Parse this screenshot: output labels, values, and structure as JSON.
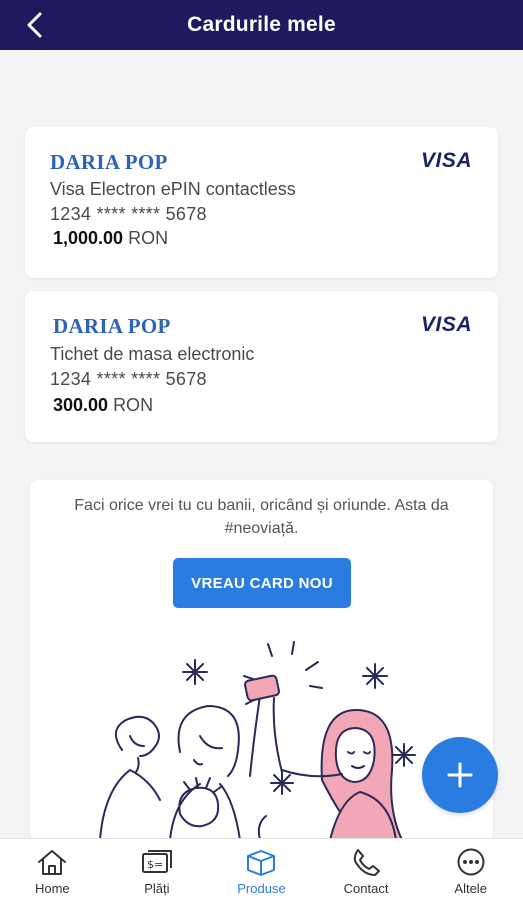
{
  "header": {
    "title": "Cardurile mele"
  },
  "cards": [
    {
      "owner": "DARIA POP",
      "brand": "VISA",
      "type": "Visa Electron ePIN contactless",
      "number": "1234 **** **** 5678",
      "amount": "1,000.00",
      "currency": "RON"
    },
    {
      "owner": "DARIA POP",
      "brand": "VISA",
      "type": "Tichet de masa electronic",
      "number": "1234 **** **** 5678",
      "amount": "300.00",
      "currency": "RON"
    }
  ],
  "promo": {
    "text": "Faci orice vrei tu cu banii, oricând și oriunde. Asta da #neoviață.",
    "cta_label": "VREAU CARD NOU"
  },
  "fab": {
    "icon": "plus-icon"
  },
  "nav": {
    "items": [
      {
        "label": "Home",
        "icon": "home-icon"
      },
      {
        "label": "Plăți",
        "icon": "payments-icon"
      },
      {
        "label": "Produse",
        "icon": "box-icon"
      },
      {
        "label": "Contact",
        "icon": "phone-icon"
      },
      {
        "label": "Altele",
        "icon": "more-icon"
      }
    ],
    "active": "Produse"
  },
  "colors": {
    "header_bg": "#1f1a5e",
    "accent": "#2a7ce0",
    "owner_text": "#2e63b8",
    "visa_text": "#1c2466",
    "illustration_stroke": "#2b2a58",
    "illustration_pink": "#f1a7b5"
  }
}
